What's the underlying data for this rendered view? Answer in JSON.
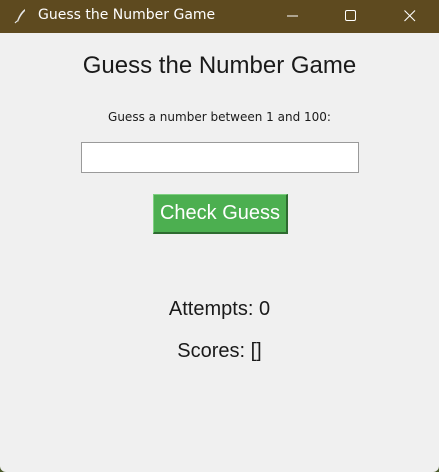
{
  "window": {
    "title": "Guess the Number Game",
    "app_icon": "feather-icon"
  },
  "titlebar_buttons": {
    "minimize_icon": "minimize-icon",
    "maximize_icon": "maximize-icon",
    "close_icon": "close-icon"
  },
  "main": {
    "heading": "Guess the Number Game",
    "prompt": "Guess a number between 1 and 100:",
    "guess_input_value": "",
    "check_button_label": "Check Guess",
    "attempts_label": "Attempts:",
    "attempts_value": "0",
    "scores_label": "Scores:",
    "scores_value": "[]"
  },
  "colors": {
    "titlebar": "#5e4a1f",
    "button_bg": "#4caf50",
    "window_bg": "#f0f0f0"
  }
}
